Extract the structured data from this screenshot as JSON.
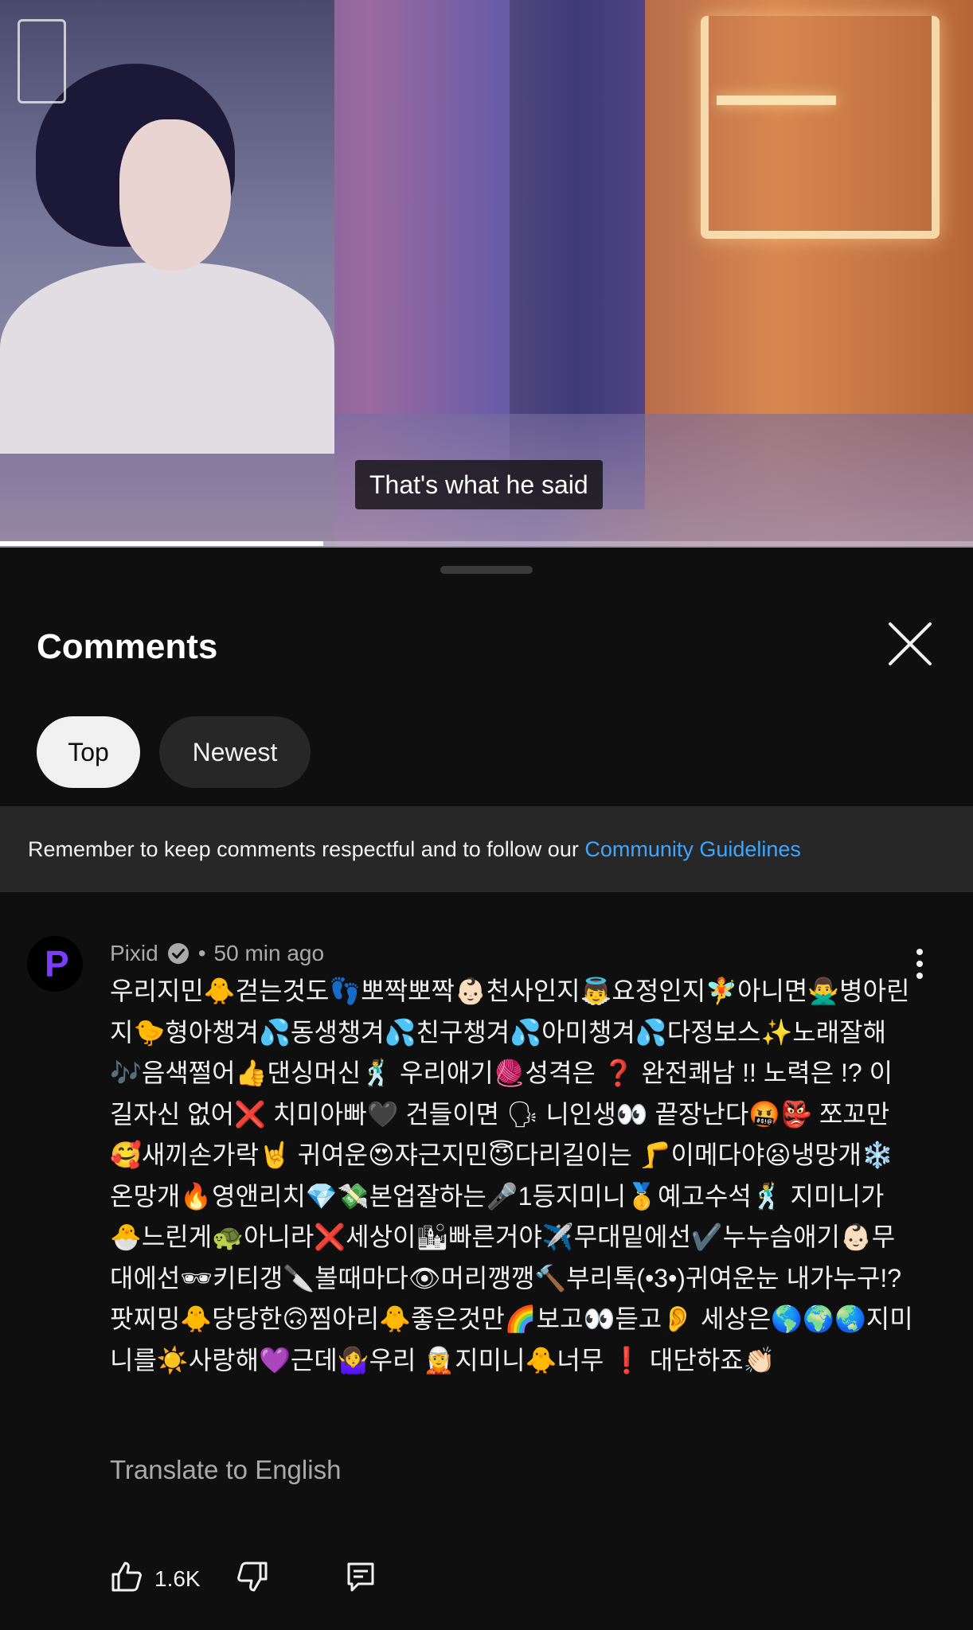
{
  "video": {
    "subtitle": "That's what he said",
    "progress_fraction": 0.332
  },
  "comments_panel": {
    "title": "Comments",
    "close_icon": "close-icon",
    "sort_chips": [
      {
        "label": "Top",
        "selected": true
      },
      {
        "label": "Newest",
        "selected": false
      }
    ],
    "notice": {
      "text": "Remember to keep comments respectful and to follow our ",
      "link": "Community Guidelines"
    }
  },
  "comment": {
    "author": "Pixid",
    "verified": true,
    "separator": "•",
    "time": "50 min ago",
    "avatar_letter": "P",
    "body": "우리지민🐥걷는것도👣뽀짝뽀짝👶🏻천사인지👼요정인지🧚아니면🙅‍♂️병아린지🐤형아챙겨💦동생챙겨💦친구챙겨💦아미챙겨💦다정보스✨노래잘해🎶음색쩔어👍댄싱머신🕺 우리애기🧶성격은 ❓ 완전쾌남 !! 노력은 !? 이길자신 없어❌ 치미아빠🖤 건들이면 🗣 니인생👀 끝장난다🤬👺 쪼꼬만🥰새끼손가락🤘 귀여운😍쟈근지민😇다리길이는 🦵이메다야😦냉망개❄️온망개🔥영앤리치💎💸본업잘하는🎤1등지미니🥇예고수석🕺 지미니가🐣느린게🐢아니라❌세상이🏙빠른거야✈️무대밑에선✔️누누슴애기👶🏻무대에선🕶키티갱🔪볼때마다👁머리깽깽🔨부리톡(•3•)귀여운눈 내가누구!? 팟찌밍🐥당당한🙃찜아리🐥좋은것만🌈보고👀듣고👂 세상은🌎🌍🌏지미니를☀️사랑해💜근데🤷‍♀️우리 🧝지미니🐥너무 ❗ 대단하죠👏🏻",
    "translate_label": "Translate to English",
    "like_count": "1.6K",
    "icons": {
      "like": "thumbs-up-icon",
      "dislike": "thumbs-down-icon",
      "reply": "reply-icon",
      "more": "more-vertical-icon",
      "verified": "verified-check-icon"
    }
  },
  "colors": {
    "background": "#0f0f0f",
    "banner_bg": "#272727",
    "link": "#3ea6ff",
    "secondary_text": "#aaaaaa",
    "chip_selected_bg": "#f1f1f1",
    "chip_bg": "#272727",
    "avatar_accent": "#7a3cff"
  }
}
